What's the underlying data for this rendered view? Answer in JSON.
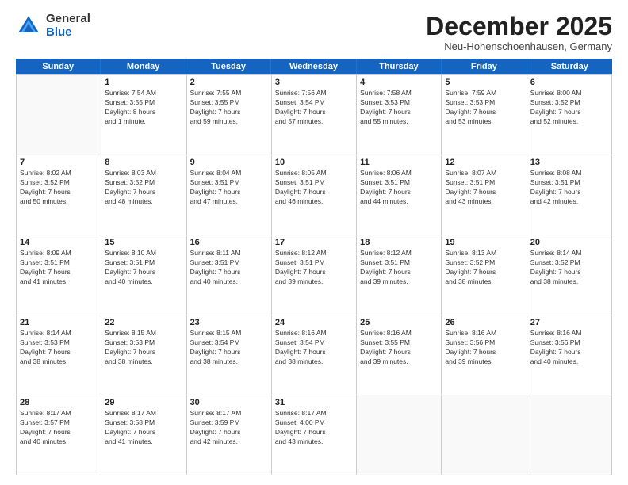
{
  "logo": {
    "general": "General",
    "blue": "Blue"
  },
  "title": "December 2025",
  "location": "Neu-Hohenschoenhausen, Germany",
  "weekdays": [
    "Sunday",
    "Monday",
    "Tuesday",
    "Wednesday",
    "Thursday",
    "Friday",
    "Saturday"
  ],
  "weeks": [
    [
      {
        "day": "",
        "info": ""
      },
      {
        "day": "1",
        "info": "Sunrise: 7:54 AM\nSunset: 3:55 PM\nDaylight: 8 hours\nand 1 minute."
      },
      {
        "day": "2",
        "info": "Sunrise: 7:55 AM\nSunset: 3:55 PM\nDaylight: 7 hours\nand 59 minutes."
      },
      {
        "day": "3",
        "info": "Sunrise: 7:56 AM\nSunset: 3:54 PM\nDaylight: 7 hours\nand 57 minutes."
      },
      {
        "day": "4",
        "info": "Sunrise: 7:58 AM\nSunset: 3:53 PM\nDaylight: 7 hours\nand 55 minutes."
      },
      {
        "day": "5",
        "info": "Sunrise: 7:59 AM\nSunset: 3:53 PM\nDaylight: 7 hours\nand 53 minutes."
      },
      {
        "day": "6",
        "info": "Sunrise: 8:00 AM\nSunset: 3:52 PM\nDaylight: 7 hours\nand 52 minutes."
      }
    ],
    [
      {
        "day": "7",
        "info": "Sunrise: 8:02 AM\nSunset: 3:52 PM\nDaylight: 7 hours\nand 50 minutes."
      },
      {
        "day": "8",
        "info": "Sunrise: 8:03 AM\nSunset: 3:52 PM\nDaylight: 7 hours\nand 48 minutes."
      },
      {
        "day": "9",
        "info": "Sunrise: 8:04 AM\nSunset: 3:51 PM\nDaylight: 7 hours\nand 47 minutes."
      },
      {
        "day": "10",
        "info": "Sunrise: 8:05 AM\nSunset: 3:51 PM\nDaylight: 7 hours\nand 46 minutes."
      },
      {
        "day": "11",
        "info": "Sunrise: 8:06 AM\nSunset: 3:51 PM\nDaylight: 7 hours\nand 44 minutes."
      },
      {
        "day": "12",
        "info": "Sunrise: 8:07 AM\nSunset: 3:51 PM\nDaylight: 7 hours\nand 43 minutes."
      },
      {
        "day": "13",
        "info": "Sunrise: 8:08 AM\nSunset: 3:51 PM\nDaylight: 7 hours\nand 42 minutes."
      }
    ],
    [
      {
        "day": "14",
        "info": "Sunrise: 8:09 AM\nSunset: 3:51 PM\nDaylight: 7 hours\nand 41 minutes."
      },
      {
        "day": "15",
        "info": "Sunrise: 8:10 AM\nSunset: 3:51 PM\nDaylight: 7 hours\nand 40 minutes."
      },
      {
        "day": "16",
        "info": "Sunrise: 8:11 AM\nSunset: 3:51 PM\nDaylight: 7 hours\nand 40 minutes."
      },
      {
        "day": "17",
        "info": "Sunrise: 8:12 AM\nSunset: 3:51 PM\nDaylight: 7 hours\nand 39 minutes."
      },
      {
        "day": "18",
        "info": "Sunrise: 8:12 AM\nSunset: 3:51 PM\nDaylight: 7 hours\nand 39 minutes."
      },
      {
        "day": "19",
        "info": "Sunrise: 8:13 AM\nSunset: 3:52 PM\nDaylight: 7 hours\nand 38 minutes."
      },
      {
        "day": "20",
        "info": "Sunrise: 8:14 AM\nSunset: 3:52 PM\nDaylight: 7 hours\nand 38 minutes."
      }
    ],
    [
      {
        "day": "21",
        "info": "Sunrise: 8:14 AM\nSunset: 3:53 PM\nDaylight: 7 hours\nand 38 minutes."
      },
      {
        "day": "22",
        "info": "Sunrise: 8:15 AM\nSunset: 3:53 PM\nDaylight: 7 hours\nand 38 minutes."
      },
      {
        "day": "23",
        "info": "Sunrise: 8:15 AM\nSunset: 3:54 PM\nDaylight: 7 hours\nand 38 minutes."
      },
      {
        "day": "24",
        "info": "Sunrise: 8:16 AM\nSunset: 3:54 PM\nDaylight: 7 hours\nand 38 minutes."
      },
      {
        "day": "25",
        "info": "Sunrise: 8:16 AM\nSunset: 3:55 PM\nDaylight: 7 hours\nand 39 minutes."
      },
      {
        "day": "26",
        "info": "Sunrise: 8:16 AM\nSunset: 3:56 PM\nDaylight: 7 hours\nand 39 minutes."
      },
      {
        "day": "27",
        "info": "Sunrise: 8:16 AM\nSunset: 3:56 PM\nDaylight: 7 hours\nand 40 minutes."
      }
    ],
    [
      {
        "day": "28",
        "info": "Sunrise: 8:17 AM\nSunset: 3:57 PM\nDaylight: 7 hours\nand 40 minutes."
      },
      {
        "day": "29",
        "info": "Sunrise: 8:17 AM\nSunset: 3:58 PM\nDaylight: 7 hours\nand 41 minutes."
      },
      {
        "day": "30",
        "info": "Sunrise: 8:17 AM\nSunset: 3:59 PM\nDaylight: 7 hours\nand 42 minutes."
      },
      {
        "day": "31",
        "info": "Sunrise: 8:17 AM\nSunset: 4:00 PM\nDaylight: 7 hours\nand 43 minutes."
      },
      {
        "day": "",
        "info": ""
      },
      {
        "day": "",
        "info": ""
      },
      {
        "day": "",
        "info": ""
      }
    ]
  ]
}
